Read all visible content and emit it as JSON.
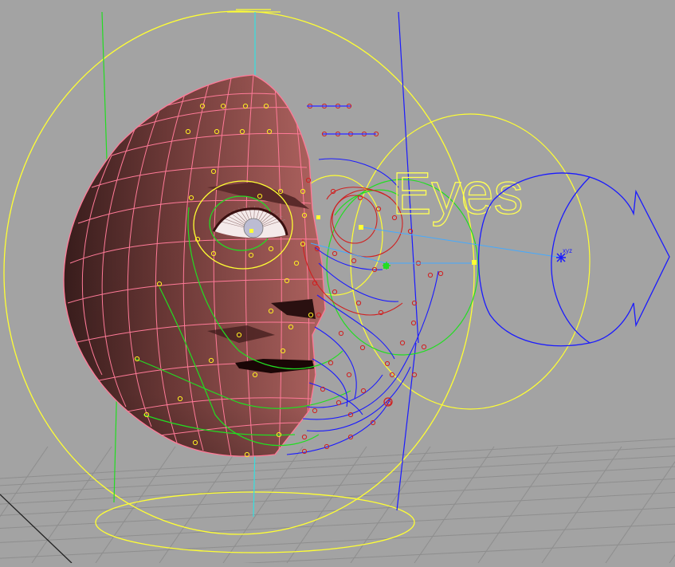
{
  "viewport": {
    "background": "#a3a3a3",
    "grid_color": "#8e8e8e",
    "controller_colors": {
      "head": "#ffff33",
      "spline": "#1a1aff",
      "helper": "#22dd22",
      "point": "#d02020",
      "mesh": "#ff7a98",
      "skin": "#e58a8a"
    }
  },
  "scene": {
    "eyes_label": "Eyes",
    "pivot_axis_label": "xyz"
  }
}
